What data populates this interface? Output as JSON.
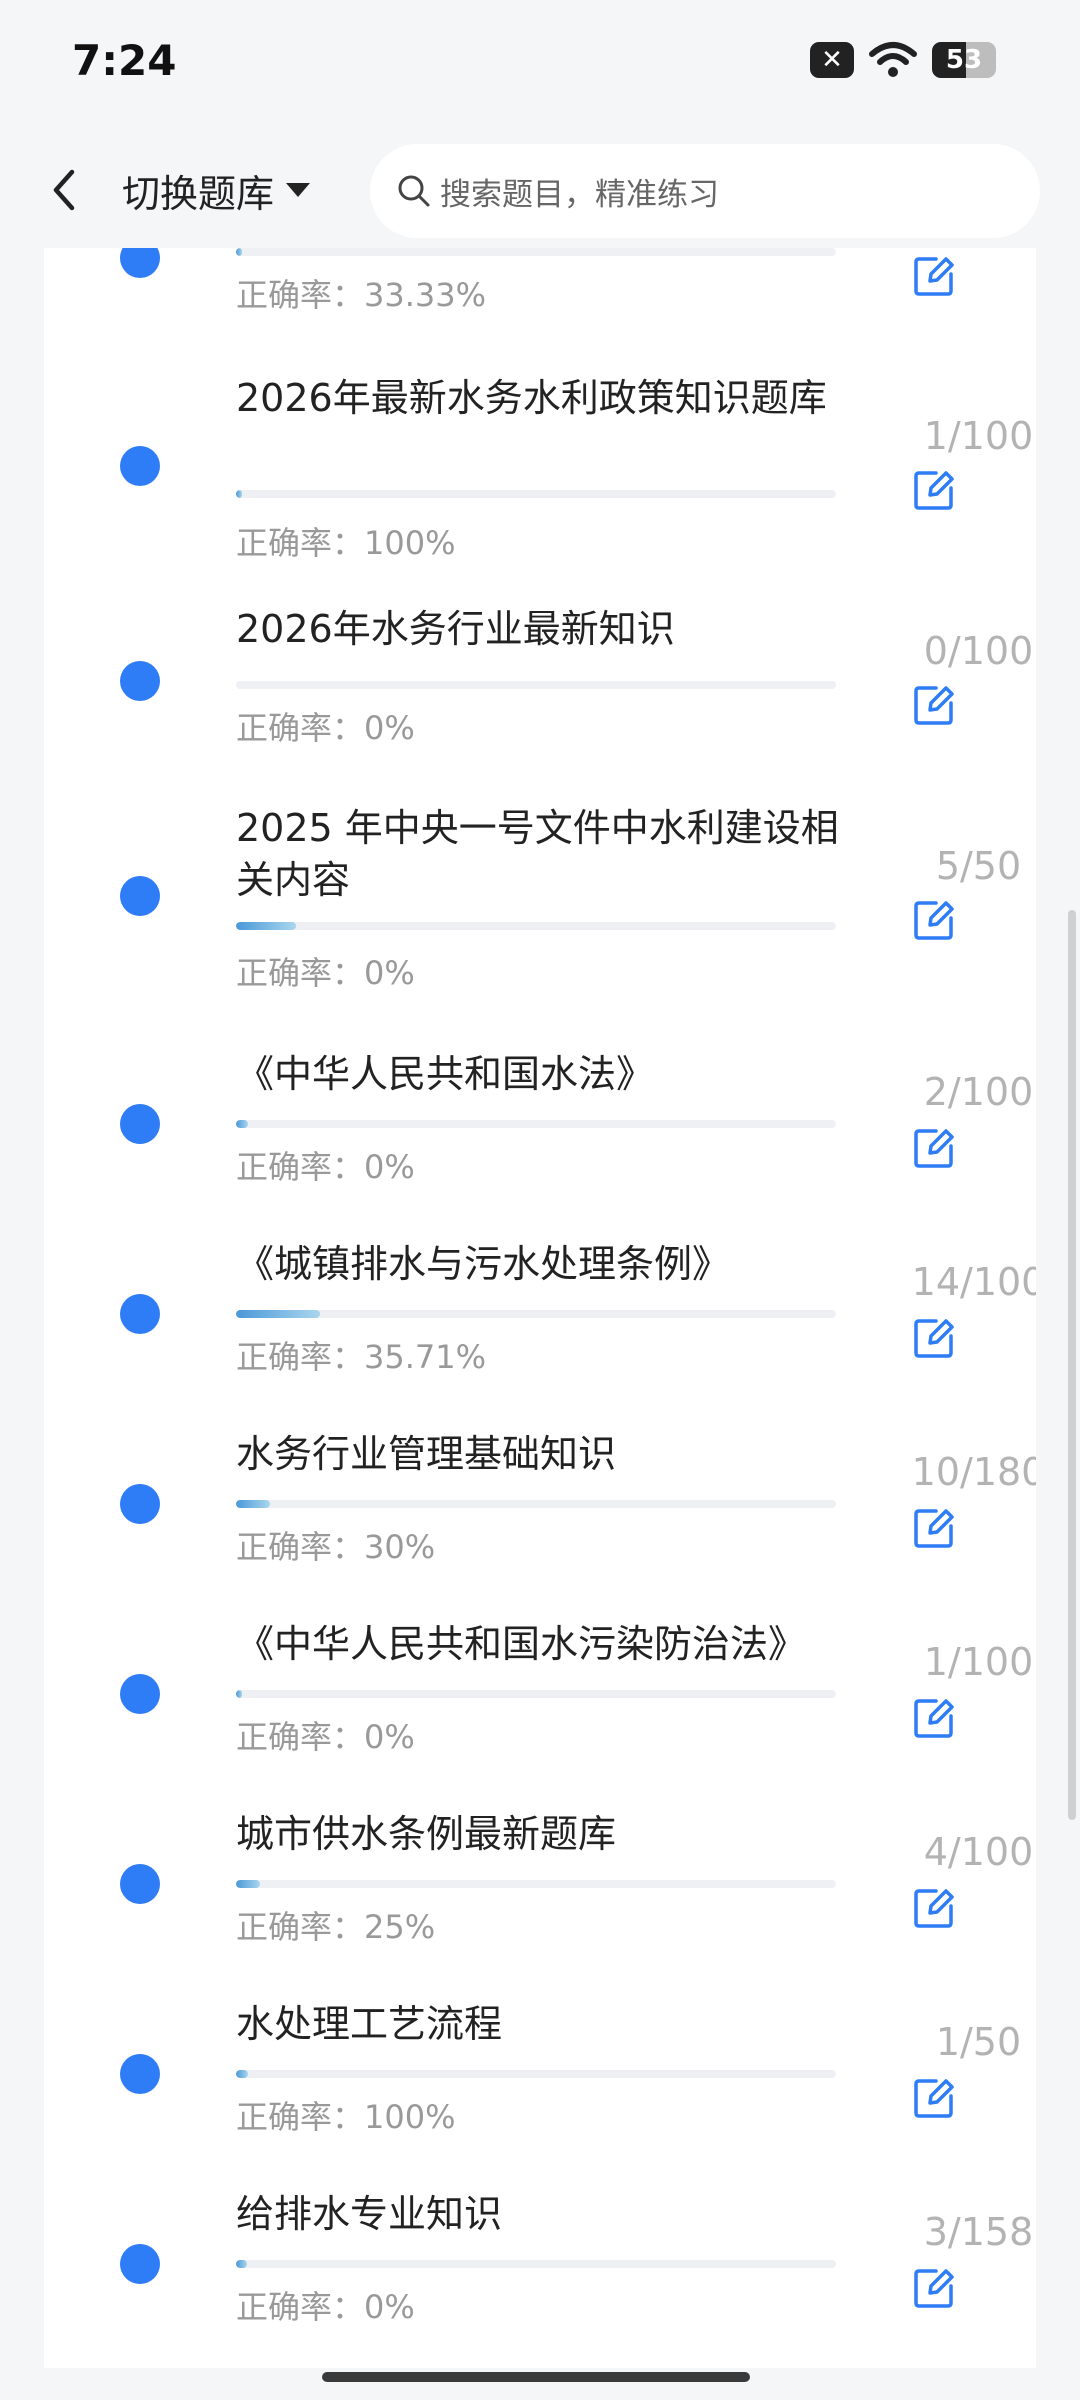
{
  "status_bar": {
    "time": "7:24",
    "notif_glyph": "✕",
    "battery": "53"
  },
  "header": {
    "switch_label": "切换题库",
    "search_placeholder": "搜索题目，精准练习"
  },
  "accent_color": "#2e7cf6",
  "items": [
    {
      "title": "",
      "progress_fraction": 0.005,
      "accuracy": "正确率：33.33%",
      "count": ""
    },
    {
      "title": "2026年最新水务水利政策知识题库",
      "progress_fraction": 0.01,
      "accuracy": "正确率：100%",
      "count": "1/100"
    },
    {
      "title": "2026年水务行业最新知识",
      "progress_fraction": 0.0,
      "accuracy": "正确率：0%",
      "count": "0/100"
    },
    {
      "title": "2025 年中央一号文件中水利建设相关内容",
      "progress_fraction": 0.1,
      "accuracy": "正确率：0%",
      "count": "5/50"
    },
    {
      "title": "《中华人民共和国水法》",
      "progress_fraction": 0.02,
      "accuracy": "正确率：0%",
      "count": "2/100"
    },
    {
      "title": "《城镇排水与污水处理条例》",
      "progress_fraction": 0.14,
      "accuracy": "正确率：35.71%",
      "count": "14/100"
    },
    {
      "title": "水务行业管理基础知识",
      "progress_fraction": 0.056,
      "accuracy": "正确率：30%",
      "count": "10/180"
    },
    {
      "title": "《中华人民共和国水污染防治法》",
      "progress_fraction": 0.01,
      "accuracy": "正确率：0%",
      "count": "1/100"
    },
    {
      "title": "城市供水条例最新题库",
      "progress_fraction": 0.04,
      "accuracy": "正确率：25%",
      "count": "4/100"
    },
    {
      "title": "水处理工艺流程",
      "progress_fraction": 0.02,
      "accuracy": "正确率：100%",
      "count": "1/50"
    },
    {
      "title": "给排水专业知识",
      "progress_fraction": 0.019,
      "accuracy": "正确率：0%",
      "count": "3/158"
    }
  ]
}
